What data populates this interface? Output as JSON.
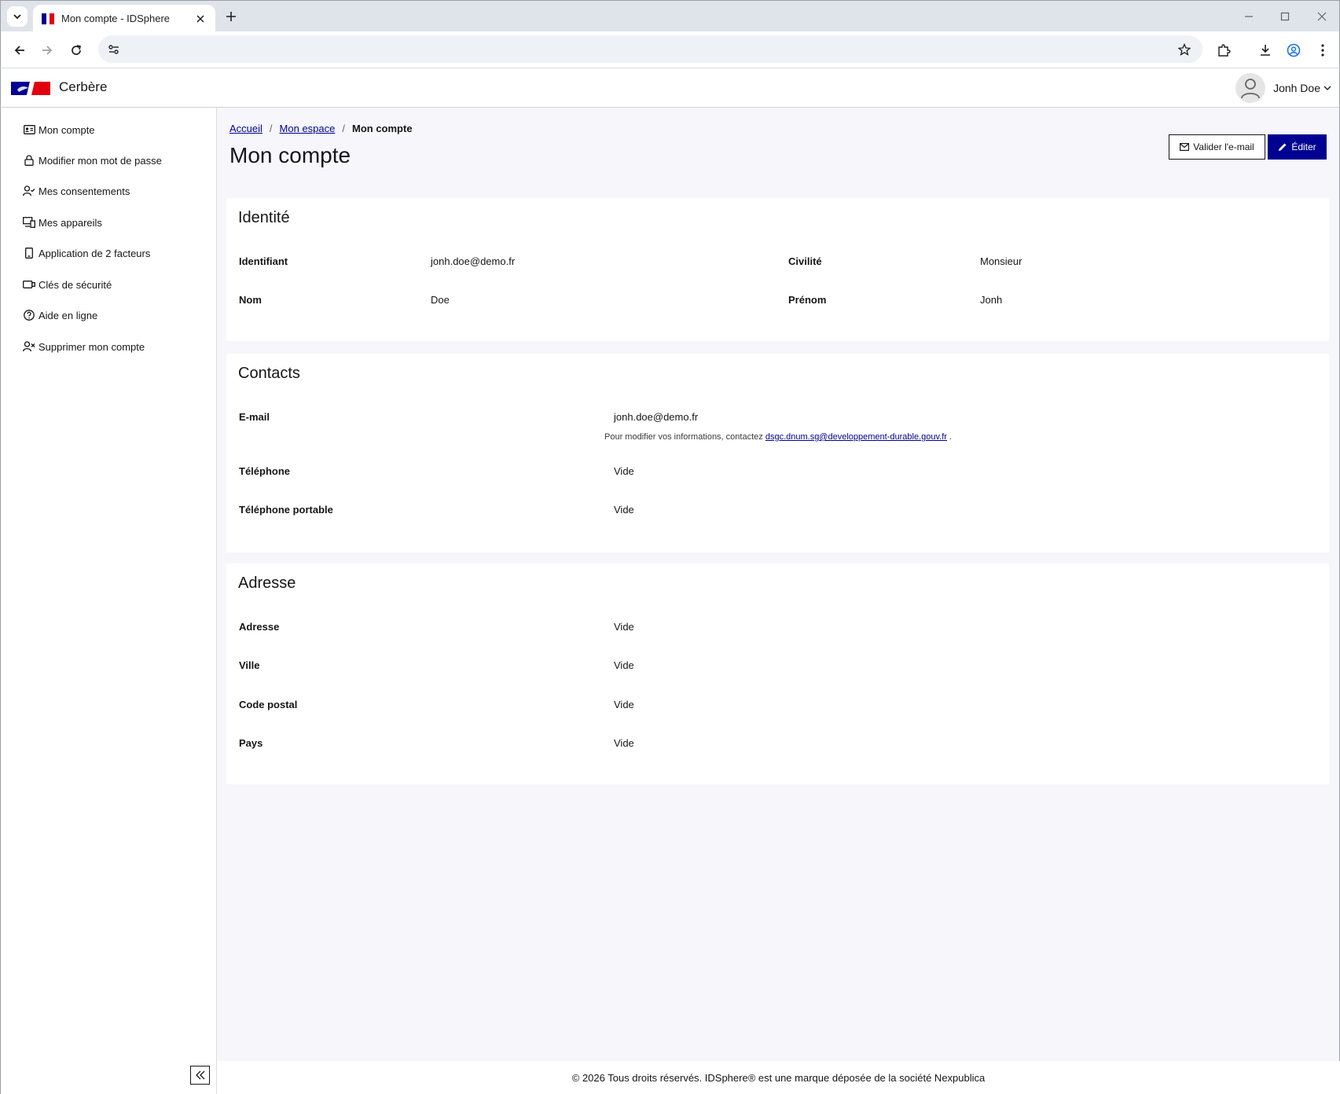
{
  "browser": {
    "tab_title": "Mon compte - IDSphere",
    "address": ""
  },
  "header": {
    "brand": "Cerbère",
    "user_name": "Jonh Doe"
  },
  "sidebar": {
    "items": [
      {
        "label": "Mon compte",
        "icon": "id-card-icon"
      },
      {
        "label": "Modifier mon mot de passe",
        "icon": "lock-icon"
      },
      {
        "label": "Mes consentements",
        "icon": "user-check-icon"
      },
      {
        "label": "Mes appareils",
        "icon": "devices-icon"
      },
      {
        "label": "Application de 2 facteurs",
        "icon": "phone-icon"
      },
      {
        "label": "Clés de sécurité",
        "icon": "security-key-icon"
      },
      {
        "label": "Aide en ligne",
        "icon": "help-circle-icon"
      },
      {
        "label": "Supprimer mon compte",
        "icon": "user-delete-icon"
      }
    ]
  },
  "breadcrumb": {
    "home": "Accueil",
    "space": "Mon espace",
    "current": "Mon compte"
  },
  "page": {
    "title": "Mon compte",
    "validate_email_label": "Valider l'e-mail",
    "edit_label": "Éditer"
  },
  "identity": {
    "title": "Identité",
    "identifiant_label": "Identifiant",
    "identifiant_value": "jonh.doe@demo.fr",
    "civilite_label": "Civilité",
    "civilite_value": "Monsieur",
    "nom_label": "Nom",
    "nom_value": "Doe",
    "prenom_label": "Prénom",
    "prenom_value": "Jonh"
  },
  "contacts": {
    "title": "Contacts",
    "email_label": "E-mail",
    "email_value": "jonh.doe@demo.fr",
    "note_prefix": "Pour modifier vos informations, contactez",
    "note_email": "dsgc.dnum.sg@developpement-durable.gouv.fr",
    "note_suffix": ".",
    "phone_label": "Téléphone",
    "phone_value": "Vide",
    "mobile_label": "Téléphone portable",
    "mobile_value": "Vide"
  },
  "address": {
    "title": "Adresse",
    "address_label": "Adresse",
    "address_value": "Vide",
    "city_label": "Ville",
    "city_value": "Vide",
    "postal_label": "Code postal",
    "postal_value": "Vide",
    "country_label": "Pays",
    "country_value": "Vide"
  },
  "footer": {
    "text": "© 2026 Tous droits réservés. IDSphere® est une marque déposée de la société Nexpublica"
  },
  "colors": {
    "primary": "#000091",
    "marianne_red": "#e1000f",
    "page_bg": "#f6f6fb"
  }
}
